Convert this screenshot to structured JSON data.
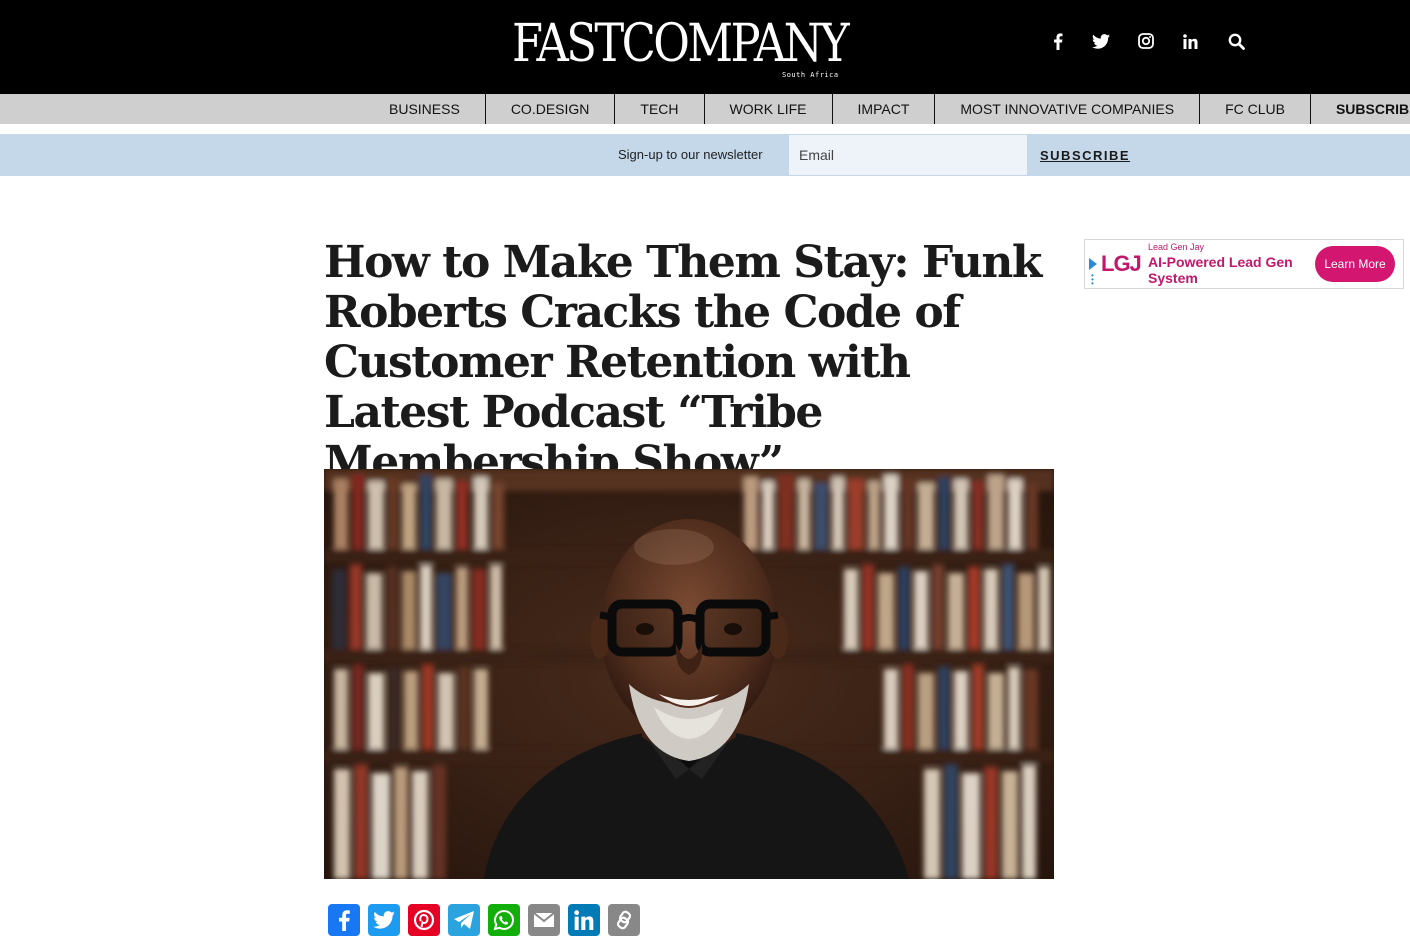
{
  "header": {
    "logo_text": "FASTCOMPANY",
    "logo_subtext": "South Africa",
    "social_icons": [
      "facebook-icon",
      "twitter-icon",
      "instagram-icon",
      "linkedin-icon",
      "search-icon"
    ]
  },
  "nav": {
    "items": [
      {
        "label": "BUSINESS"
      },
      {
        "label": "CO.DESIGN"
      },
      {
        "label": "TECH"
      },
      {
        "label": "WORK LIFE"
      },
      {
        "label": "IMPACT"
      },
      {
        "label": "MOST INNOVATIVE COMPANIES"
      },
      {
        "label": "FC CLUB"
      },
      {
        "label": "SUBSCRIBE"
      }
    ]
  },
  "newsletter": {
    "label": "Sign-up to our newsletter",
    "email_placeholder": "Email",
    "button": "SUBSCRIBE"
  },
  "article": {
    "headline": "How to Make Them Stay: Funk Roberts Cracks the Code of Customer Retention with Latest Podcast “Tribe Membership Show”"
  },
  "ad": {
    "logo": "LGJ",
    "brand": "Lead Gen Jay",
    "title": "AI-Powered Lead Gen System",
    "button": "Learn More"
  },
  "share": {
    "buttons": [
      "Facebook",
      "Twitter",
      "Pinterest",
      "Telegram",
      "WhatsApp",
      "Email",
      "LinkedIn",
      "Copy Link"
    ]
  },
  "colors": {
    "topbar": "#000000",
    "navbar": "#cfcfcf",
    "newsletter_bg": "#c4d8ea",
    "ad_accent": "#d3166f",
    "facebook": "#1877f2",
    "twitter": "#1d9bf0",
    "pinterest": "#e60023",
    "telegram": "#2aa3df",
    "whatsapp": "#12af0a",
    "email": "#888888",
    "linkedin": "#007bb5",
    "copy": "#888888"
  }
}
